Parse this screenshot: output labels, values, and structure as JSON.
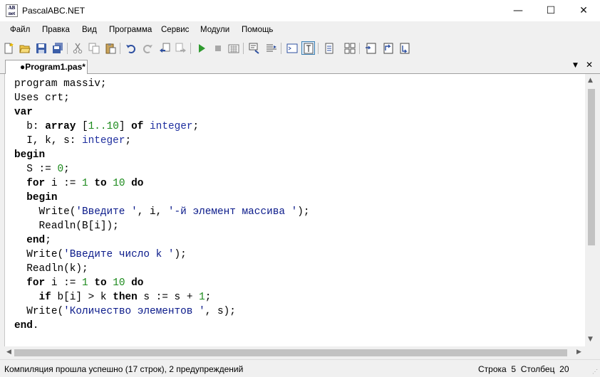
{
  "window": {
    "title": "PascalABC.NET",
    "icon_text": [
      "AB",
      "net"
    ],
    "minimize_glyph": "—",
    "maximize_glyph": "☐",
    "close_glyph": "✕"
  },
  "menu": [
    {
      "label": "Файл"
    },
    {
      "label": "Правка"
    },
    {
      "label": "Вид"
    },
    {
      "label": "Программа"
    },
    {
      "label": "Сервис"
    },
    {
      "label": "Модули"
    },
    {
      "label": "Помощь"
    }
  ],
  "toolbar_icons": [
    "new-file-icon",
    "open-folder-icon",
    "save-icon",
    "save-all-icon",
    "cut-icon",
    "copy-icon",
    "paste-icon",
    "undo-icon",
    "redo-icon",
    "navigate-back-icon",
    "navigate-forward-icon",
    "run-icon",
    "stop-icon",
    "compile-icon",
    "debug-output-icon",
    "goto-line-icon",
    "output-window-icon",
    "code-editor-icon",
    "breakpoint-icon",
    "watch-icon",
    "step-into-icon",
    "step-over-icon",
    "step-out-icon"
  ],
  "tab": {
    "label": "●Program1.pas*",
    "dropdown_glyph": "▼",
    "close_glyph": "✕"
  },
  "colors": {
    "keyword": "#000000",
    "type": "#1f2f9f",
    "number": "#1b8a1b",
    "string": "#0a1a8a",
    "text": "#000000"
  },
  "code_lines": [
    [
      {
        "t": "program massiv;",
        "c": "p"
      }
    ],
    [
      {
        "t": "Uses crt;",
        "c": "p"
      }
    ],
    [
      {
        "t": "var",
        "c": "k"
      }
    ],
    [
      {
        "t": "  b: ",
        "c": "p"
      },
      {
        "t": "array",
        "c": "k"
      },
      {
        "t": " [",
        "c": "p"
      },
      {
        "t": "1..10",
        "c": "n"
      },
      {
        "t": "] ",
        "c": "p"
      },
      {
        "t": "of",
        "c": "k"
      },
      {
        "t": " ",
        "c": "p"
      },
      {
        "t": "integer",
        "c": "t"
      },
      {
        "t": ";",
        "c": "p"
      }
    ],
    [
      {
        "t": "  I, k, s: ",
        "c": "p"
      },
      {
        "t": "integer",
        "c": "t"
      },
      {
        "t": ";",
        "c": "p"
      }
    ],
    [
      {
        "t": "begin",
        "c": "k"
      }
    ],
    [
      {
        "t": "  S := ",
        "c": "p"
      },
      {
        "t": "0",
        "c": "n"
      },
      {
        "t": ";",
        "c": "p"
      }
    ],
    [
      {
        "t": "  ",
        "c": "p"
      },
      {
        "t": "for",
        "c": "k"
      },
      {
        "t": " i := ",
        "c": "p"
      },
      {
        "t": "1",
        "c": "n"
      },
      {
        "t": " ",
        "c": "p"
      },
      {
        "t": "to",
        "c": "k"
      },
      {
        "t": " ",
        "c": "p"
      },
      {
        "t": "10",
        "c": "n"
      },
      {
        "t": " ",
        "c": "p"
      },
      {
        "t": "do",
        "c": "k"
      }
    ],
    [
      {
        "t": "  ",
        "c": "p"
      },
      {
        "t": "begin",
        "c": "k"
      }
    ],
    [
      {
        "t": "    Write(",
        "c": "p"
      },
      {
        "t": "'Введите '",
        "c": "s"
      },
      {
        "t": ", i, ",
        "c": "p"
      },
      {
        "t": "'-й элемент массива '",
        "c": "s"
      },
      {
        "t": ");",
        "c": "p"
      }
    ],
    [
      {
        "t": "    Readln(B[i]);",
        "c": "p"
      }
    ],
    [
      {
        "t": "  ",
        "c": "p"
      },
      {
        "t": "end",
        "c": "k"
      },
      {
        "t": ";",
        "c": "p"
      }
    ],
    [
      {
        "t": "  Write(",
        "c": "p"
      },
      {
        "t": "'Введите число k '",
        "c": "s"
      },
      {
        "t": ");",
        "c": "p"
      }
    ],
    [
      {
        "t": "  Readln(k);",
        "c": "p"
      }
    ],
    [
      {
        "t": "  ",
        "c": "p"
      },
      {
        "t": "for",
        "c": "k"
      },
      {
        "t": " i := ",
        "c": "p"
      },
      {
        "t": "1",
        "c": "n"
      },
      {
        "t": " ",
        "c": "p"
      },
      {
        "t": "to",
        "c": "k"
      },
      {
        "t": " ",
        "c": "p"
      },
      {
        "t": "10",
        "c": "n"
      },
      {
        "t": " ",
        "c": "p"
      },
      {
        "t": "do",
        "c": "k"
      }
    ],
    [
      {
        "t": "    ",
        "c": "p"
      },
      {
        "t": "if",
        "c": "k"
      },
      {
        "t": " b[i] > k ",
        "c": "p"
      },
      {
        "t": "then",
        "c": "k"
      },
      {
        "t": " s := s + ",
        "c": "p"
      },
      {
        "t": "1",
        "c": "n"
      },
      {
        "t": ";",
        "c": "p"
      }
    ],
    [
      {
        "t": "  Write(",
        "c": "p"
      },
      {
        "t": "'Количество элементов '",
        "c": "s"
      },
      {
        "t": ", s);",
        "c": "p"
      }
    ],
    [
      {
        "t": "end",
        "c": "k"
      },
      {
        "t": ".",
        "c": "p"
      }
    ]
  ],
  "scrollbar": {
    "up": "▲",
    "down": "▼",
    "left": "◀",
    "right": "▶"
  },
  "status": {
    "message": "Компиляция прошла успешно (17 строк), 2 предупреждений",
    "line_label": "Строка",
    "line_value": "5",
    "col_label": "Столбец",
    "col_value": "20",
    "grip": "⋰"
  }
}
